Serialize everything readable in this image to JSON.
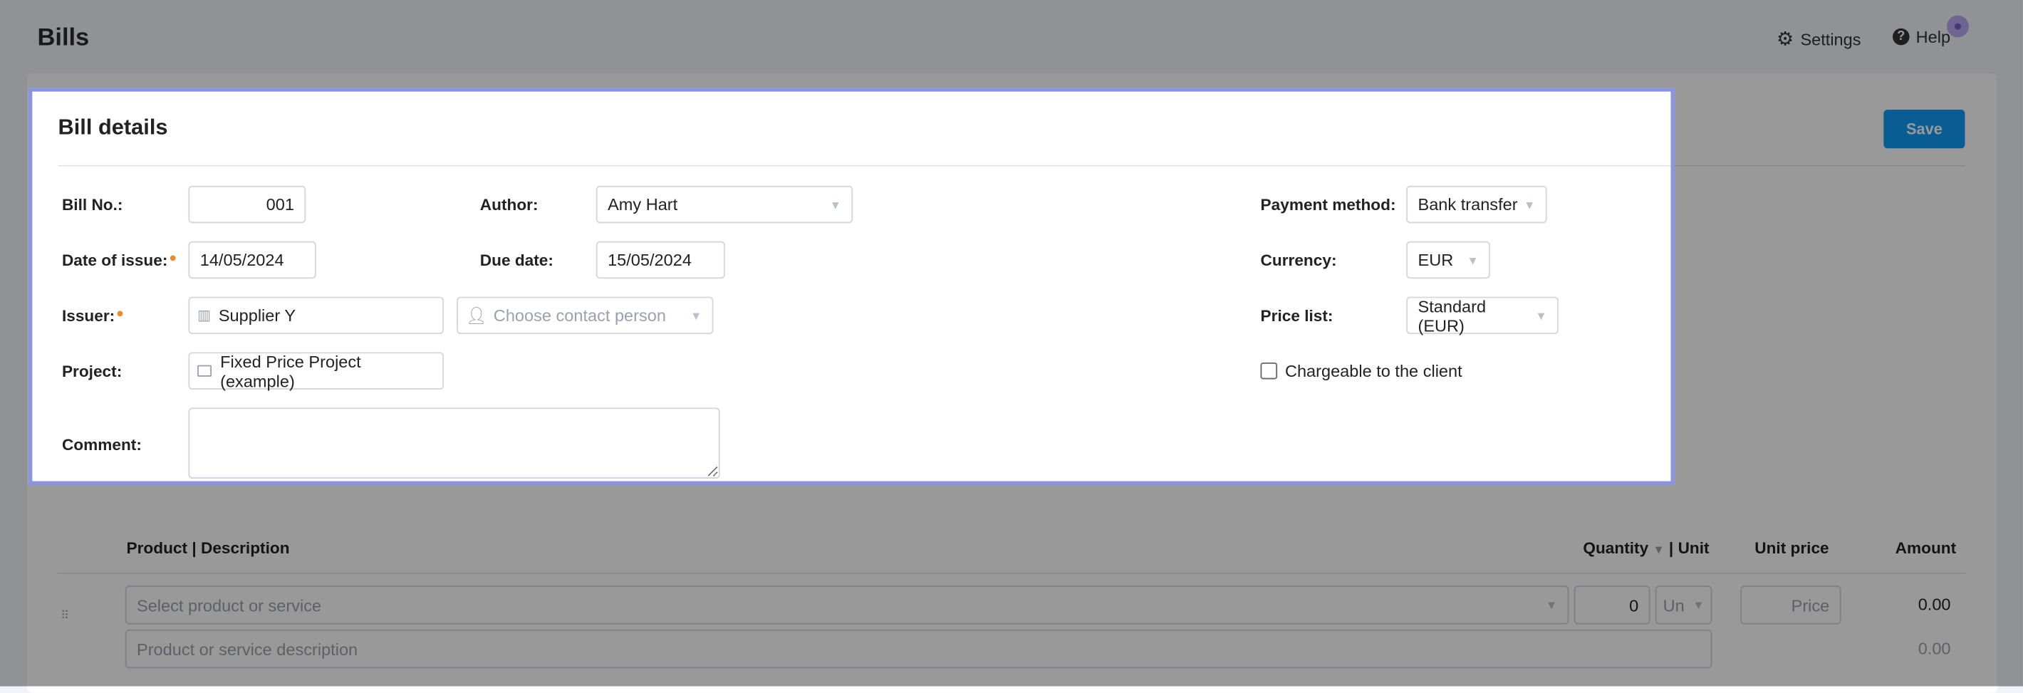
{
  "page": {
    "title": "Bills",
    "settings_label": "Settings",
    "help_label": "Help",
    "save_label": "Save"
  },
  "table": {
    "headers": {
      "product": "Product",
      "description": "Description",
      "quantity": "Quantity",
      "unit": "Unit",
      "unit_price": "Unit price",
      "amount": "Amount"
    },
    "row": {
      "product_placeholder": "Select product or service",
      "quantity": "0",
      "unit_placeholder": "Un",
      "price_placeholder": "Price",
      "amount": "0.00",
      "description_placeholder": "Product or service description",
      "description_amount": "0.00"
    }
  },
  "modal": {
    "title": "Bill details",
    "bill_no": {
      "label": "Bill No.:",
      "value": "001"
    },
    "author": {
      "label": "Author:",
      "value": "Amy Hart"
    },
    "date_of_issue": {
      "label": "Date of issue:",
      "value": "14/05/2024",
      "required": true
    },
    "due_date": {
      "label": "Due date:",
      "value": "15/05/2024"
    },
    "issuer": {
      "label": "Issuer:",
      "value": "Supplier Y",
      "required": true,
      "contact_placeholder": "Choose contact person"
    },
    "project": {
      "label": "Project:",
      "value": "Fixed Price Project (example)"
    },
    "comment": {
      "label": "Comment:",
      "value": ""
    },
    "payment_method": {
      "label": "Payment method:",
      "value": "Bank transfer"
    },
    "currency": {
      "label": "Currency:",
      "value": "EUR"
    },
    "price_list": {
      "label": "Price list:",
      "value": "Standard (EUR)"
    },
    "chargeable": {
      "label": "Chargeable to the client",
      "checked": false
    }
  },
  "colors": {
    "accent": "#0f9cf5",
    "modal_border": "#8b94e2",
    "required": "#f08a2c",
    "notification": "#7b5cc7"
  }
}
